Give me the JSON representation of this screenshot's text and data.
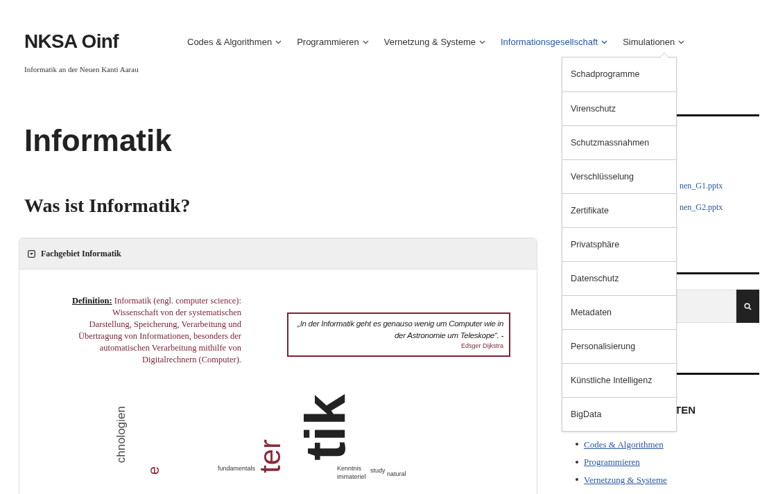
{
  "site": {
    "title": "NKSA Oinf",
    "tagline": "Informatik an der Neuen Kanti Aarau"
  },
  "nav": [
    {
      "label": "Codes & Algorithmen",
      "selected": false
    },
    {
      "label": "Programmieren",
      "selected": false
    },
    {
      "label": "Vernetzung & Systeme",
      "selected": false
    },
    {
      "label": "Informationsgesellschaft",
      "selected": true
    },
    {
      "label": "Simulationen",
      "selected": false
    }
  ],
  "dropdown": [
    "Schadprogramme",
    "Virenschutz",
    "Schutzmassnahmen",
    "Verschlüsselung",
    "Zertifikate",
    "Privatsphäre",
    "Datenschutz",
    "Metadaten",
    "Personalisierung",
    "Künstliche Intelligenz",
    "BigData"
  ],
  "page_title": "Informatik",
  "section_title": "Was ist Informatik?",
  "panel": {
    "title": "Fachgebiet Informatik",
    "expanded": true,
    "definition": {
      "label": "Definition:",
      "text": "Informatik (engl. computer science): Wissenschaft von der systematischen Darstellung, Speicherung, Verarbeitung und Übertragung von Informationen, besonders der automatischen Verarbeitung mithilfe von Digitalrechnern (Computer)."
    },
    "quote": {
      "text": "„In der Informatik geht es genauso wenig um Computer wie in der Astronomie um Teleskope“. -",
      "author": "Edsger Dijkstra"
    },
    "cloud_words": [
      {
        "text": "chnologien",
        "kind": "vertical",
        "color": "#444444"
      },
      {
        "text": "e",
        "kind": "vertical",
        "color": "#8b2a3a"
      },
      {
        "text": "fundamentals",
        "kind": "small"
      },
      {
        "text": "ter",
        "kind": "vertical",
        "color": "#8b2a3a"
      },
      {
        "text": "tik",
        "kind": "big",
        "color": "#222222"
      },
      {
        "text": "Kenntnis",
        "kind": "small"
      },
      {
        "text": "immateriel",
        "kind": "small"
      },
      {
        "text": "study",
        "kind": "small"
      },
      {
        "text": "natural",
        "kind": "small"
      }
    ]
  },
  "sidebar": {
    "files": [
      "nen_G1.pptx",
      "nen_G2.pptx"
    ],
    "heading": "TEN",
    "links": [
      "Codes & Algorithmen",
      "Programmieren",
      "Vernetzung & Systeme"
    ]
  }
}
